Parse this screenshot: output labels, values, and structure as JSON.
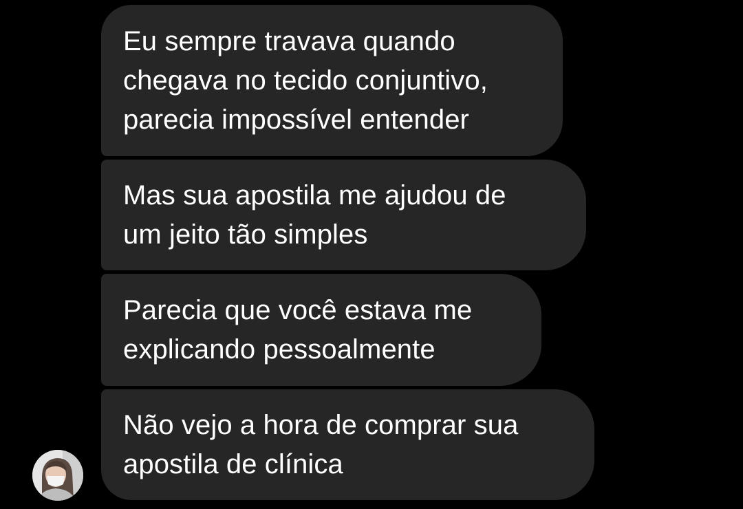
{
  "conversation": {
    "messages": [
      {
        "text": "Eu sempre travava quando\nchegava no tecido conjuntivo,\nparecia impossível entender"
      },
      {
        "text": "Mas sua apostila me ajudou de\num jeito tão simples"
      },
      {
        "text": "Parecia que você estava me\nexplicando pessoalmente"
      },
      {
        "text": "Não vejo a hora de comprar sua\napostila de clínica"
      }
    ],
    "sender_avatar": {
      "icon": "user-photo-avatar"
    }
  },
  "colors": {
    "background": "#000000",
    "bubble": "#262626",
    "text": "#ffffff"
  }
}
